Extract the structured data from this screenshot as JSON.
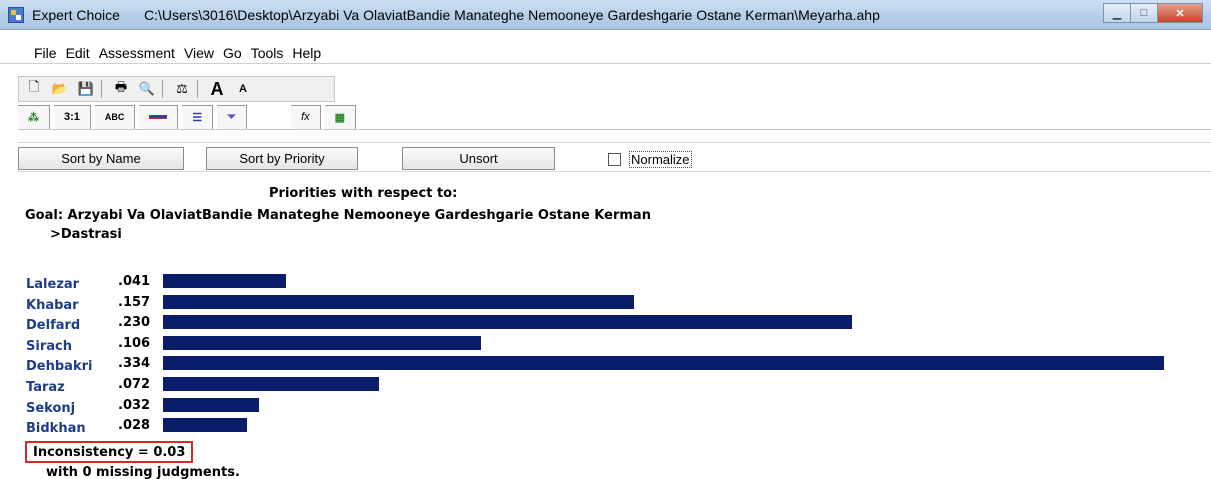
{
  "window": {
    "app_name": "Expert Choice",
    "file_path": "C:\\Users\\3016\\Desktop\\Arzyabi Va OlaviatBandie Manateghe Nemooneye Gardeshgarie Ostane Kerman\\Meyarha.ahp",
    "minimize_symbol": "▁",
    "maximize_symbol": "□",
    "close_symbol": "✕"
  },
  "menu": {
    "items": [
      "File",
      "Edit",
      "Assessment",
      "View",
      "Go",
      "Tools",
      "Help"
    ]
  },
  "toolbar1": {
    "buttons": [
      "new-icon",
      "open-icon",
      "save-icon",
      "print-icon",
      "preview-icon",
      "balance-icon",
      "font-larger-icon",
      "font-smaller-icon"
    ]
  },
  "toolbar2": {
    "tabs": [
      {
        "label": "",
        "icon": "tree-icon"
      },
      {
        "label": "3:1",
        "icon": ""
      },
      {
        "label": "ABC",
        "icon": ""
      },
      {
        "label": "",
        "icon": "bar-red-icon"
      },
      {
        "label": "",
        "icon": "bars-icon"
      },
      {
        "label": "",
        "icon": "funnel-icon"
      },
      {
        "label": "fx",
        "icon": ""
      },
      {
        "label": "",
        "icon": "grid-icon"
      }
    ]
  },
  "sortbar": {
    "sort_by_name": "Sort by Name",
    "sort_by_priority": "Sort by Priority",
    "unsort": "Unsort",
    "normalize": "Normalize",
    "normalize_checked": false
  },
  "priorities": {
    "heading": "Priorities with respect to:",
    "goal": "Goal: Arzyabi Va OlaviatBandie Manateghe Nemooneye Gardeshgarie Ostane Kerman",
    "subnode": ">Dastrasi",
    "inconsistency": "Inconsistency = 0.03",
    "missing": "with 0  missing judgments."
  },
  "chart_data": {
    "type": "bar",
    "orientation": "horizontal",
    "categories": [
      "Lalezar",
      "Khabar",
      "Delfard",
      "Sirach",
      "Dehbakri",
      "Taraz",
      "Sekonj",
      "Bidkhan"
    ],
    "values": [
      0.041,
      0.157,
      0.23,
      0.106,
      0.334,
      0.072,
      0.032,
      0.028
    ],
    "value_labels": [
      ".041",
      ".157",
      ".230",
      ".106",
      ".334",
      ".072",
      ".032",
      ".028"
    ],
    "bar_color": "#0a1d6b",
    "label_color": "#1f3c88"
  }
}
